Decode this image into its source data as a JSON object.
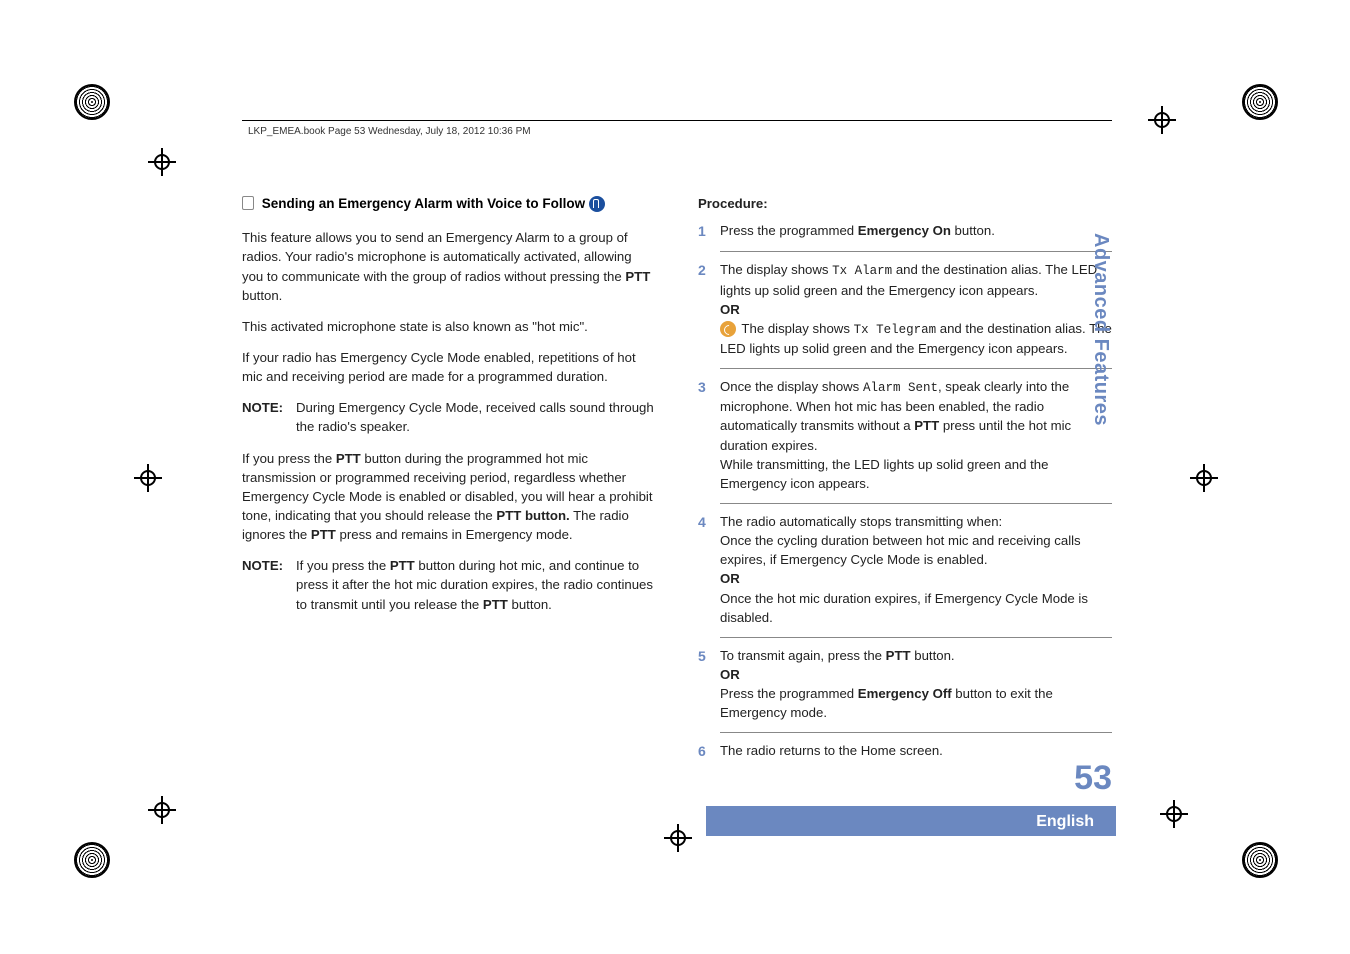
{
  "header": {
    "running": "LKP_EMEA.book  Page 53  Wednesday, July 18, 2012  10:36 PM"
  },
  "sideTab": "Advanced Features",
  "pageNumber": "53",
  "language": "English",
  "section": {
    "title_prefix": "Sending an Emergency Alarm with Voice to Follow",
    "paras": [
      "This feature allows you to send an Emergency Alarm to a group of radios. Your radio's microphone is automatically activated, allowing you to communicate with the group of radios without pressing the ",
      "This activated microphone state is also known as \"hot mic\".",
      "If your radio has Emergency Cycle Mode enabled, repetitions of hot mic and receiving period are made for a programmed duration."
    ],
    "ptt_label": "PTT",
    "after_ptt_1": " button.",
    "note1_label": "NOTE:",
    "note1_body": "During Emergency Cycle Mode, received calls sound through the radio's speaker.",
    "para4_a": "If you press the ",
    "para4_b": " button during the programmed hot mic transmission or programmed receiving period, regardless whether Emergency Cycle Mode is enabled or disabled, you will hear a prohibit tone, indicating that you should release the ",
    "para4_c": " button.",
    "para4_d": " The radio ignores the ",
    "para4_e": " press and remains in Emergency mode.",
    "note2_label": "NOTE:",
    "note2_a": "If you press the ",
    "note2_b": " button during hot mic, and continue to press it after the hot mic duration expires, the radio continues to transmit until you release the ",
    "note2_c": " button."
  },
  "procedure": {
    "title": "Procedure:",
    "emergency_on": "Emergency On",
    "emergency_off": "Emergency Off",
    "or": "OR",
    "steps": {
      "s1_a": "Press the programmed ",
      "s1_b": " button.",
      "s2_a": "The display shows ",
      "s2_tx_alarm": "Tx Alarm",
      "s2_b": " and the destination alias. The LED lights up solid green and the Emergency icon appears.",
      "s2_c": " The display shows ",
      "s2_tx_telegram": "Tx Telegram",
      "s2_d": " and the destination alias. The LED lights up solid green and the Emergency icon appears.",
      "s3_a": "Once the display shows ",
      "s3_alarm_sent": "Alarm Sent",
      "s3_b": ", speak clearly into the microphone. When hot mic has been enabled, the radio automatically transmits without a ",
      "s3_c": " press until the hot mic duration expires.",
      "s3_d": "While transmitting, the LED lights up solid green and the Emergency icon appears.",
      "s4_a": "The radio automatically stops transmitting when:",
      "s4_b": "Once the cycling duration between hot mic and receiving calls expires, if Emergency Cycle Mode is enabled.",
      "s4_c": "Once the hot mic duration expires, if Emergency Cycle Mode is disabled.",
      "s5_a": "To transmit again, press the ",
      "s5_b": " button.",
      "s5_c": "Press the programmed ",
      "s5_d": " button to exit the Emergency mode.",
      "s6": "The radio returns to the Home screen."
    }
  },
  "icons": {
    "page": "page-icon",
    "follow": "blue-dot",
    "signal": "orange-dot"
  }
}
